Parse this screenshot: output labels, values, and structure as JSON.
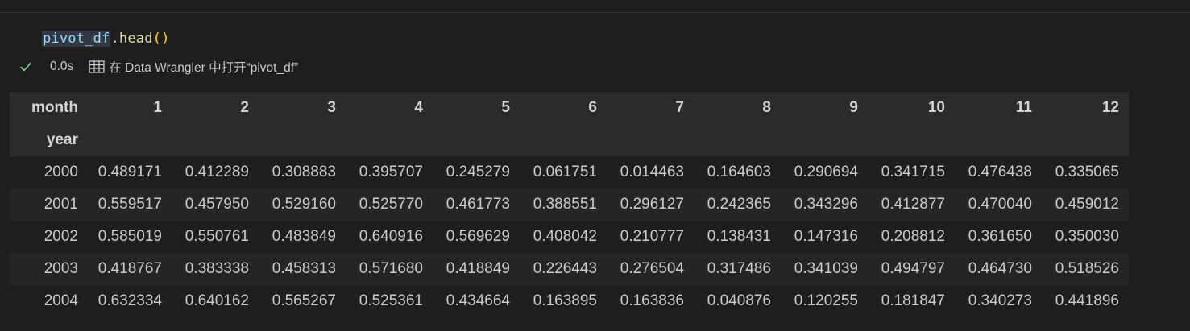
{
  "cell": {
    "code_variable": "pivot_df",
    "code_dot": ".",
    "code_method": "head",
    "code_parens": "()"
  },
  "status": {
    "check_icon": "check-icon",
    "execution_time": "0.0s",
    "wrangler_icon": "data-wrangler-icon",
    "wrangler_link": "在 Data Wrangler 中打开“pivot_df”"
  },
  "colors": {
    "background": "#1e1e1e",
    "header_background": "#2b2b2b",
    "row_alt_background": "#252526",
    "success_check": "#89d185",
    "variable": "#9cdcfe",
    "method": "#dcdcaa",
    "paren": "#ffd700"
  },
  "table": {
    "columns_name": "month",
    "index_name": "year",
    "columns": [
      "1",
      "2",
      "3",
      "4",
      "5",
      "6",
      "7",
      "8",
      "9",
      "10",
      "11",
      "12"
    ],
    "rows": [
      {
        "index": "2000",
        "values": [
          "0.489171",
          "0.412289",
          "0.308883",
          "0.395707",
          "0.245279",
          "0.061751",
          "0.014463",
          "0.164603",
          "0.290694",
          "0.341715",
          "0.476438",
          "0.335065"
        ]
      },
      {
        "index": "2001",
        "values": [
          "0.559517",
          "0.457950",
          "0.529160",
          "0.525770",
          "0.461773",
          "0.388551",
          "0.296127",
          "0.242365",
          "0.343296",
          "0.412877",
          "0.470040",
          "0.459012"
        ]
      },
      {
        "index": "2002",
        "values": [
          "0.585019",
          "0.550761",
          "0.483849",
          "0.640916",
          "0.569629",
          "0.408042",
          "0.210777",
          "0.138431",
          "0.147316",
          "0.208812",
          "0.361650",
          "0.350030"
        ]
      },
      {
        "index": "2003",
        "values": [
          "0.418767",
          "0.383338",
          "0.458313",
          "0.571680",
          "0.418849",
          "0.226443",
          "0.276504",
          "0.317486",
          "0.341039",
          "0.494797",
          "0.464730",
          "0.518526"
        ]
      },
      {
        "index": "2004",
        "values": [
          "0.632334",
          "0.640162",
          "0.565267",
          "0.525361",
          "0.434664",
          "0.163895",
          "0.163836",
          "0.040876",
          "0.120255",
          "0.181847",
          "0.340273",
          "0.441896"
        ]
      }
    ]
  }
}
